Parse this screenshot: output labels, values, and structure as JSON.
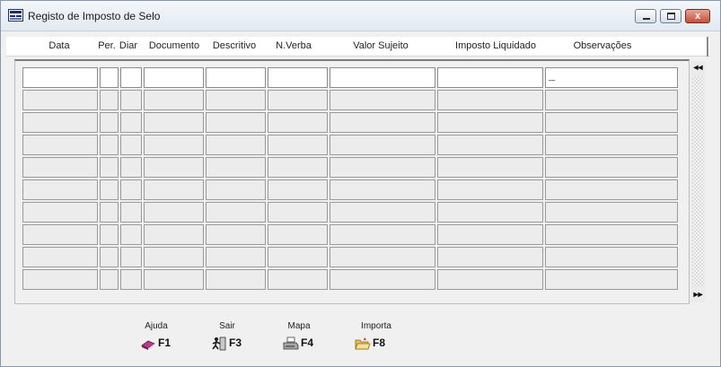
{
  "window": {
    "title": "Registo de Imposto de Selo",
    "controls": {
      "close_label": "x"
    }
  },
  "table": {
    "columns": [
      "Data",
      "Per.",
      "Diar",
      "Documento",
      "Descritivo",
      "N.Verba",
      "Valor Sujeito",
      "Imposto Liquidado",
      "Observações"
    ],
    "row_count": 10,
    "first_row_observacoes": "_"
  },
  "scrollbar": {
    "up_glyph": "◂◂",
    "down_glyph": "▸▸"
  },
  "function_keys": [
    {
      "label": "Ajuda",
      "key": "F1",
      "icon": "help-book-icon"
    },
    {
      "label": "Sair",
      "key": "F3",
      "icon": "exit-person-icon"
    },
    {
      "label": "Mapa",
      "key": "F4",
      "icon": "printer-icon"
    },
    {
      "label": "Importa",
      "key": "F8",
      "icon": "open-folder-icon"
    }
  ]
}
